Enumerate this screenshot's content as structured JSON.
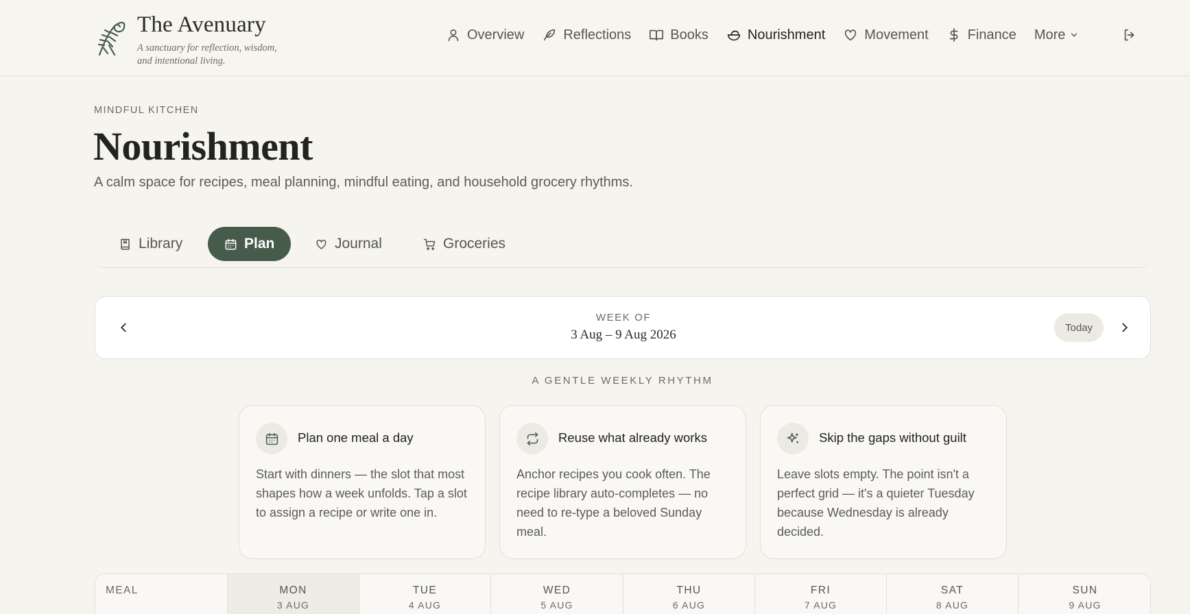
{
  "brand": {
    "title": "The Avenuary",
    "tagline": "A sanctuary for reflection, wisdom, and intentional living."
  },
  "nav": {
    "items": [
      {
        "label": "Overview",
        "icon": "user-icon"
      },
      {
        "label": "Reflections",
        "icon": "feather-icon"
      },
      {
        "label": "Books",
        "icon": "book-open-icon"
      },
      {
        "label": "Nourishment",
        "icon": "salad-bowl-icon",
        "active": true
      },
      {
        "label": "Movement",
        "icon": "heart-icon"
      },
      {
        "label": "Finance",
        "icon": "dollar-icon"
      }
    ],
    "more_label": "More"
  },
  "page": {
    "eyebrow": "MINDFUL KITCHEN",
    "title": "Nourishment",
    "subtitle": "A calm space for recipes, meal planning, mindful eating, and household grocery rhythms."
  },
  "tabs": [
    {
      "label": "Library",
      "icon": "bookmark-book-icon"
    },
    {
      "label": "Plan",
      "icon": "calendar-icon",
      "active": true
    },
    {
      "label": "Journal",
      "icon": "heart-icon"
    },
    {
      "label": "Groceries",
      "icon": "cart-icon"
    }
  ],
  "week": {
    "label": "WEEK OF",
    "range": "3 Aug – 9 Aug 2026",
    "today_label": "Today"
  },
  "rhythm": {
    "heading": "A GENTLE WEEKLY RHYTHM",
    "tips": [
      {
        "title": "Plan one meal a day",
        "icon": "calendar-icon",
        "body": "Start with dinners — the slot that most shapes how a week unfolds. Tap a slot to assign a recipe or write one in."
      },
      {
        "title": "Reuse what already works",
        "icon": "repeat-icon",
        "body": "Anchor recipes you cook often. The recipe library auto-completes — no need to re-type a beloved Sunday meal."
      },
      {
        "title": "Skip the gaps without guilt",
        "icon": "sparkle-icon",
        "body": "Leave slots empty. The point isn't a perfect grid — it's a quieter Tuesday because Wednesday is already decided."
      }
    ]
  },
  "grid": {
    "meal_label": "MEAL",
    "days": [
      {
        "day": "MON",
        "date": "3 AUG",
        "today": true
      },
      {
        "day": "TUE",
        "date": "4 AUG"
      },
      {
        "day": "WED",
        "date": "5 AUG"
      },
      {
        "day": "THU",
        "date": "6 AUG"
      },
      {
        "day": "FRI",
        "date": "7 AUG"
      },
      {
        "day": "SAT",
        "date": "8 AUG"
      },
      {
        "day": "SUN",
        "date": "9 AUG"
      }
    ]
  },
  "colors": {
    "accent": "#465b4a",
    "background": "#f6f4ef"
  }
}
